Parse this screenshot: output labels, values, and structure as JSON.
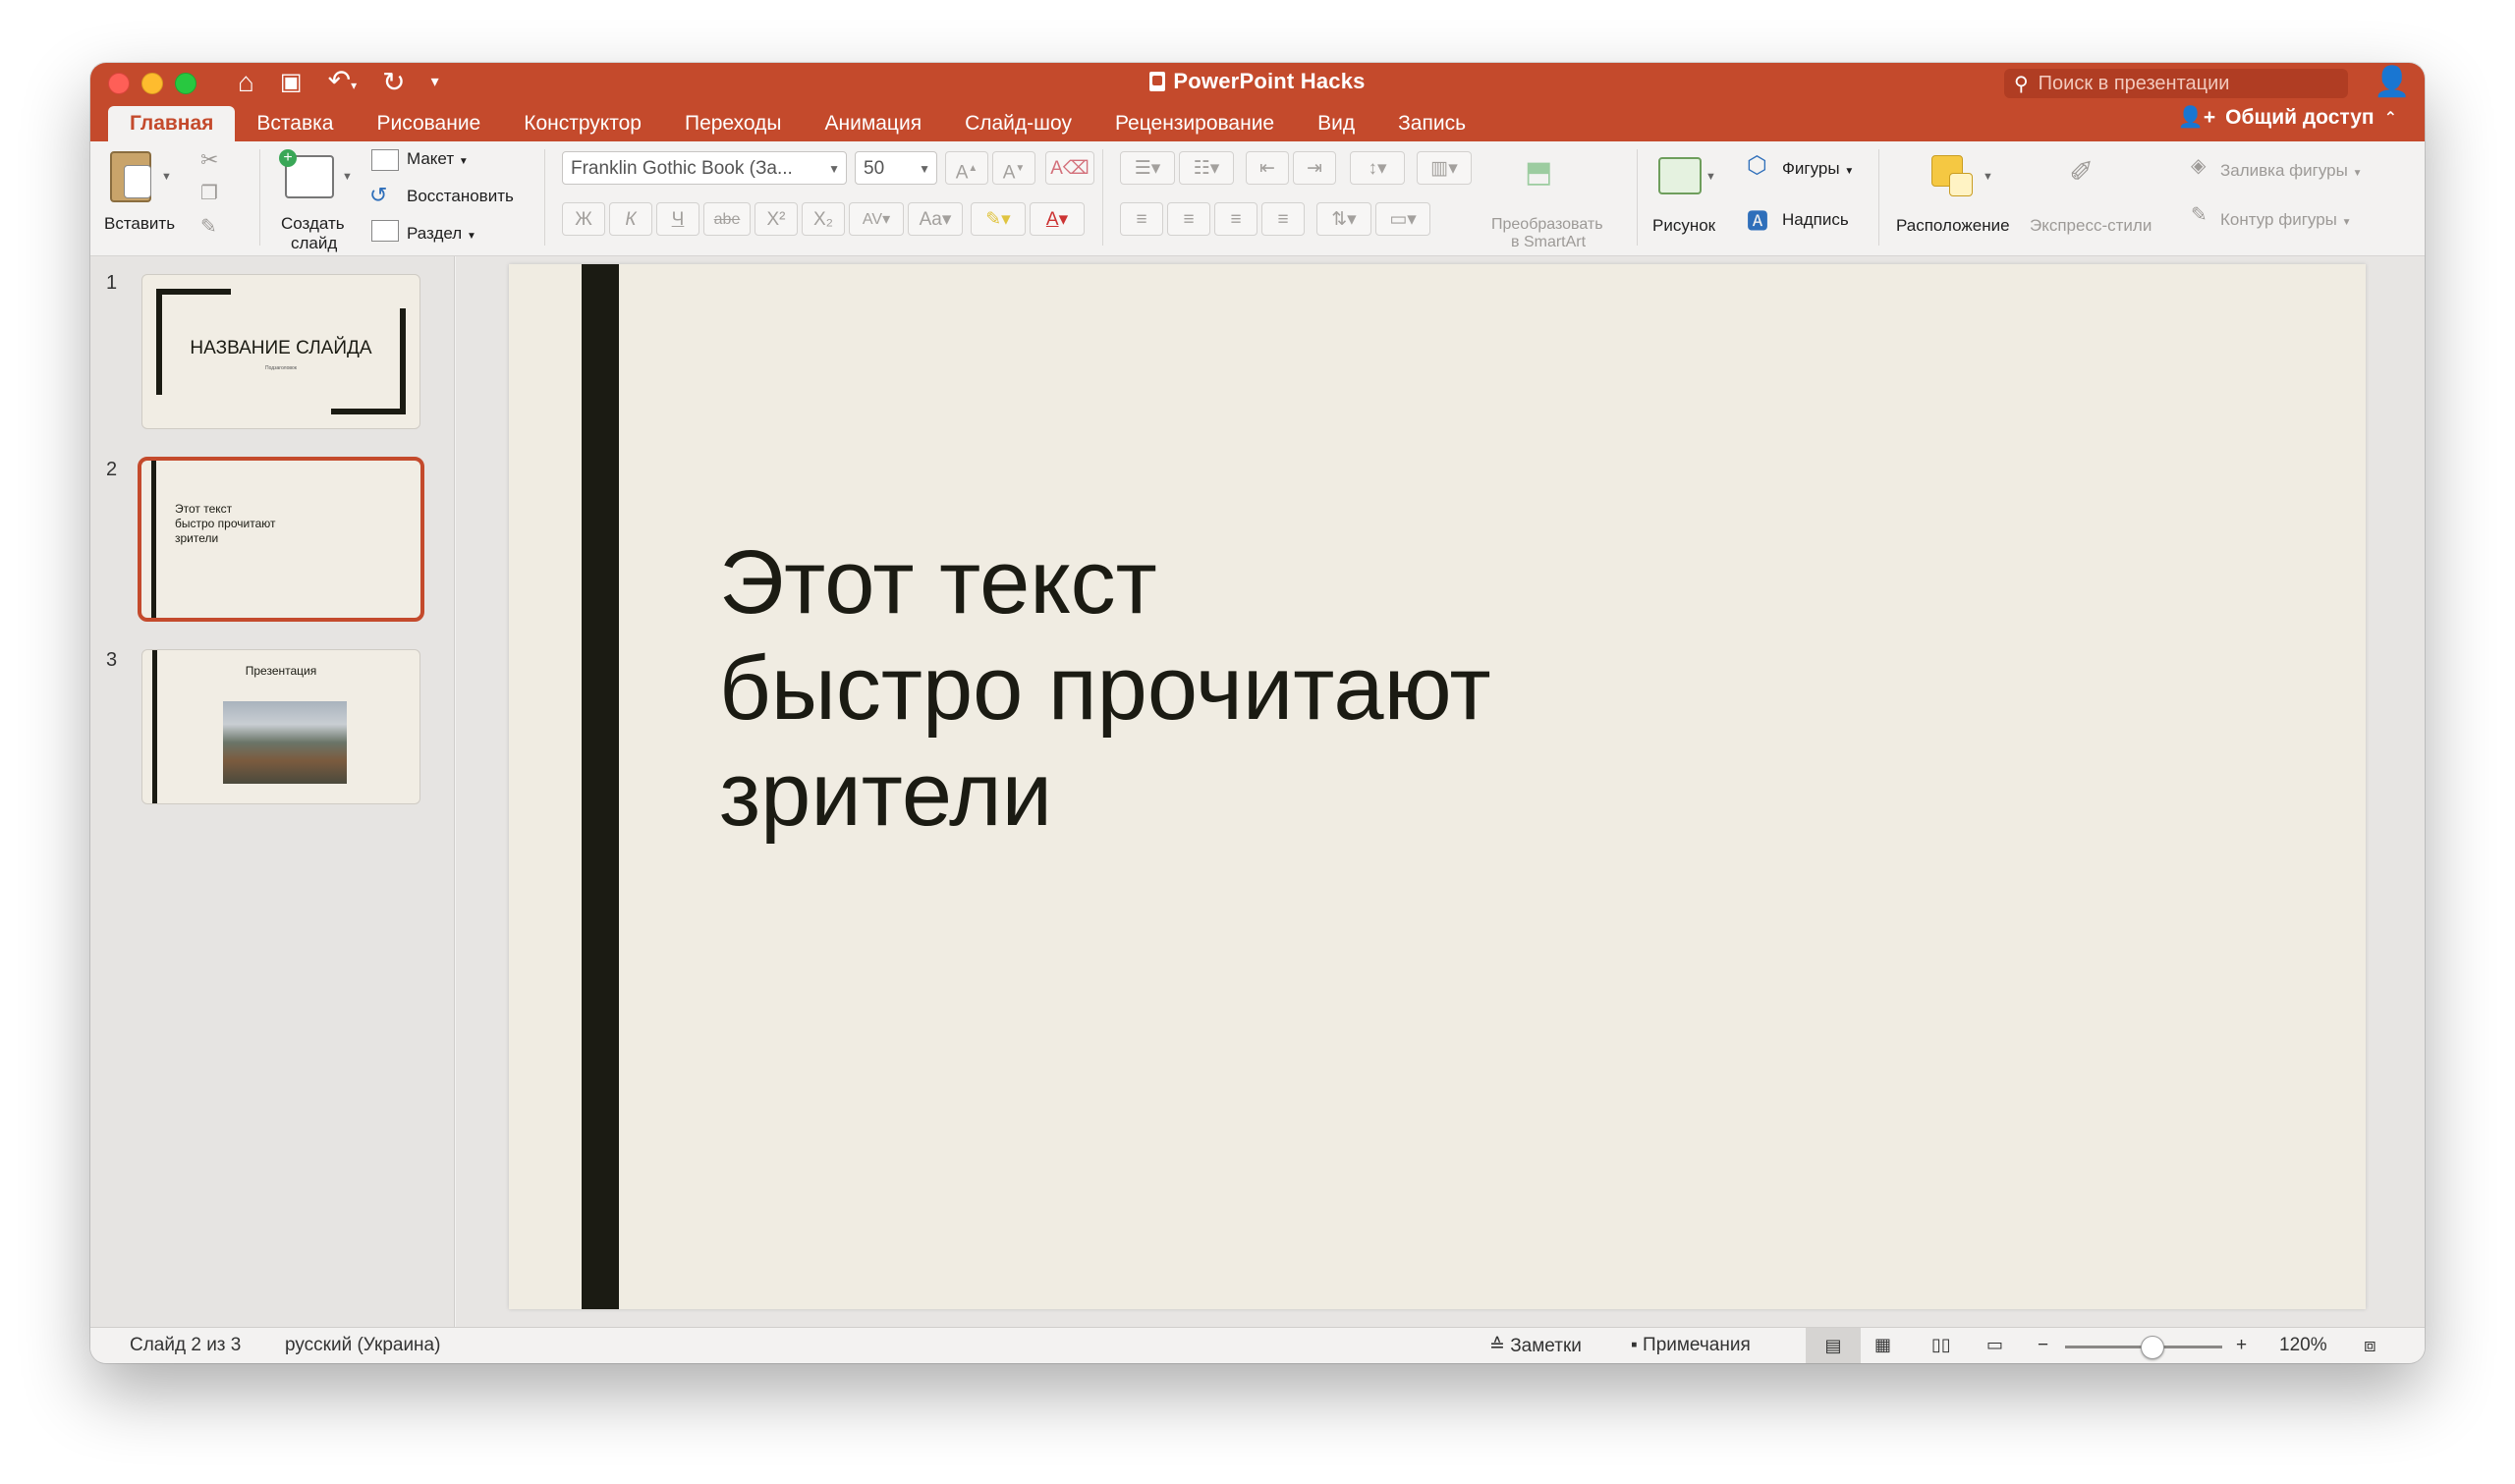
{
  "window": {
    "title": "PowerPoint Hacks"
  },
  "quick_access": [
    "home-icon",
    "save-icon",
    "undo-icon",
    "redo-icon",
    "customize-icon"
  ],
  "search": {
    "placeholder": "Поиск в презентации"
  },
  "tabs": [
    {
      "label": "Главная",
      "active": true
    },
    {
      "label": "Вставка"
    },
    {
      "label": "Рисование"
    },
    {
      "label": "Конструктор"
    },
    {
      "label": "Переходы"
    },
    {
      "label": "Анимация"
    },
    {
      "label": "Слайд-шоу"
    },
    {
      "label": "Рецензирование"
    },
    {
      "label": "Вид"
    },
    {
      "label": "Запись"
    }
  ],
  "share_label": "Общий доступ",
  "ribbon": {
    "paste": "Вставить",
    "new_slide_line1": "Создать",
    "new_slide_line2": "слайд",
    "layout": "Макет",
    "reset": "Восстановить",
    "section": "Раздел",
    "font_name": "Franklin Gothic Book (За...",
    "font_size": "50",
    "bold": "Ж",
    "italic": "К",
    "underline": "Ч",
    "strike": "abe",
    "superscript": "X²",
    "subscript": "X₂",
    "smartart_line1": "Преобразовать",
    "smartart_line2": "в SmartArt",
    "picture": "Рисунок",
    "shapes": "Фигуры",
    "textbox": "Надпись",
    "arrange": "Расположение",
    "quick_styles": "Экспресс-стили",
    "shape_fill": "Заливка фигуры",
    "shape_outline": "Контур фигуры"
  },
  "slides": [
    {
      "number": "1",
      "title": "НАЗВАНИЕ СЛАЙДА",
      "subtitle": "Подзаголовок"
    },
    {
      "number": "2",
      "line1": "Этот текст",
      "line2": "быстро прочитают",
      "line3": "зрители",
      "selected": true
    },
    {
      "number": "3",
      "title": "Презентация"
    }
  ],
  "current_slide": {
    "text": "Этот текст\nбыстро прочитают\nзрители"
  },
  "status": {
    "slide_info": "Слайд 2 из 3",
    "language": "русский (Украина)",
    "notes": "Заметки",
    "comments": "Примечания",
    "zoom": "120%",
    "zoom_level": 0.55
  },
  "colors": {
    "accent": "#c44a2c",
    "slide_bg": "#f0ece2",
    "slide_text": "#1b1b13"
  }
}
